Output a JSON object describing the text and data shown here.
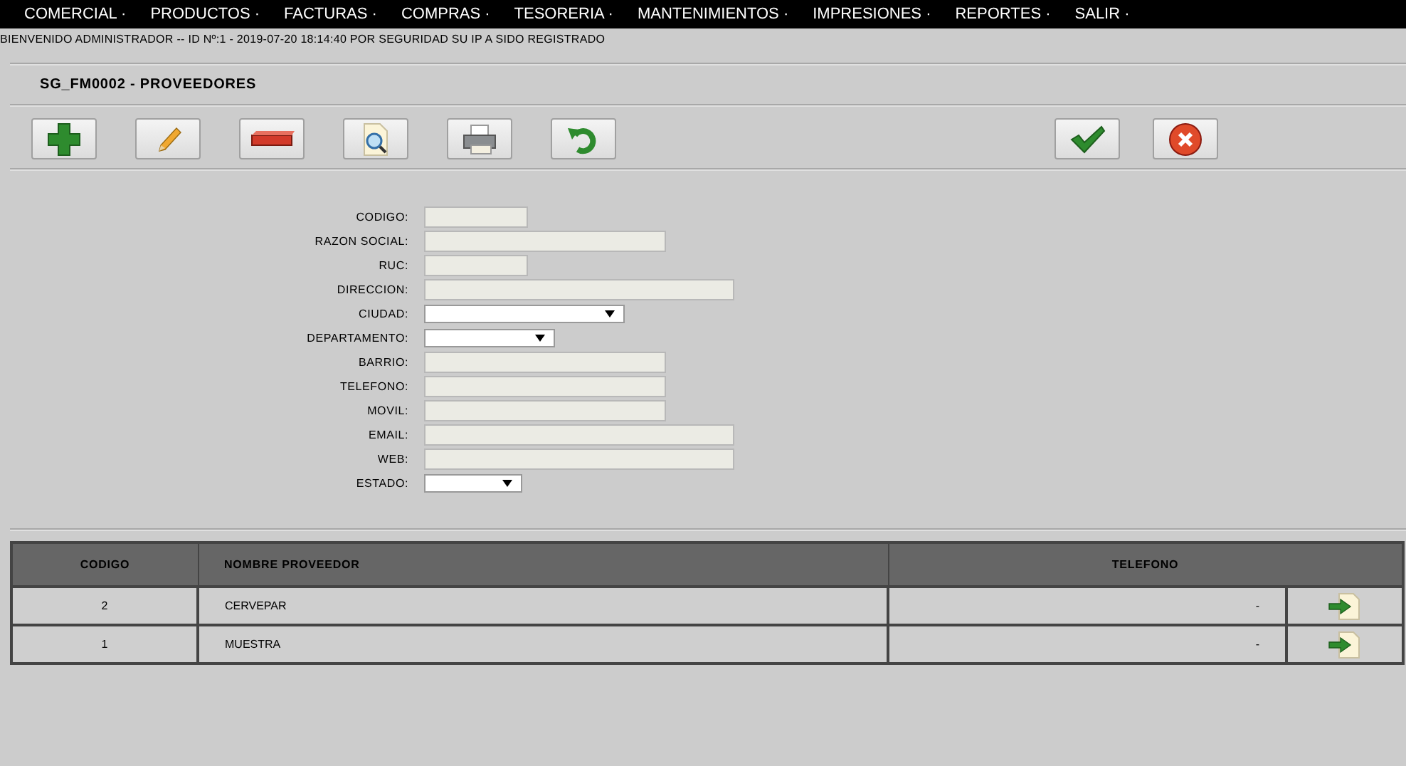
{
  "menu": [
    {
      "label": "COMERCIAL ·"
    },
    {
      "label": "PRODUCTOS ·"
    },
    {
      "label": "FACTURAS ·"
    },
    {
      "label": "COMPRAS ·"
    },
    {
      "label": "TESORERIA ·"
    },
    {
      "label": "MANTENIMIENTOS ·"
    },
    {
      "label": "IMPRESIONES ·"
    },
    {
      "label": "REPORTES ·"
    },
    {
      "label": "SALIR ·"
    }
  ],
  "welcome": "BIENVENIDO ADMINISTRADOR -- ID Nº:1 - 2019-07-20 18:14:40 POR SEGURIDAD SU IP A SIDO REGISTRADO",
  "form_title": "SG_FM0002 - PROVEEDORES",
  "toolbar": [
    {
      "kind": "add"
    },
    {
      "kind": "edit"
    },
    {
      "kind": "delete"
    },
    {
      "kind": "search"
    },
    {
      "kind": "print"
    },
    {
      "kind": "refresh"
    },
    {
      "kind": "accept"
    },
    {
      "kind": "cancel"
    }
  ],
  "fields": [
    {
      "label": "CODIGO:",
      "kind": "text"
    },
    {
      "label": "RAZON SOCIAL:",
      "kind": "text"
    },
    {
      "label": "RUC:",
      "kind": "text"
    },
    {
      "label": "DIRECCION:",
      "kind": "text"
    },
    {
      "label": "CIUDAD:",
      "kind": "select"
    },
    {
      "label": "DEPARTAMENTO:",
      "kind": "select"
    },
    {
      "label": "BARRIO:",
      "kind": "text"
    },
    {
      "label": "TELEFONO:",
      "kind": "text"
    },
    {
      "label": "MOVIL:",
      "kind": "text"
    },
    {
      "label": "EMAIL:",
      "kind": "text"
    },
    {
      "label": "WEB:",
      "kind": "text"
    },
    {
      "label": "ESTADO:",
      "kind": "select"
    }
  ],
  "table": {
    "columns": [
      "CODIGO",
      "NOMBRE PROVEEDOR",
      "TELEFONO"
    ],
    "rows": [
      {
        "codigo": "2",
        "nombre": "CERVEPAR",
        "telefono": "-"
      },
      {
        "codigo": "1",
        "nombre": "MUESTRA",
        "telefono": "-"
      }
    ]
  }
}
